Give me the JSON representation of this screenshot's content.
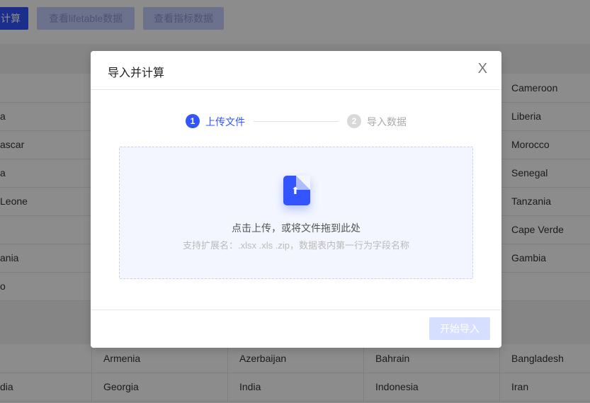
{
  "toolbar": {
    "calc": "计算",
    "lifetable": "查看lifetable数据",
    "indicator": "查看指标数据"
  },
  "table": {
    "rows": [
      [
        "",
        "",
        "",
        "",
        "Cameroon"
      ],
      [
        "a",
        "",
        "",
        "",
        "Liberia"
      ],
      [
        "ascar",
        "",
        "",
        "",
        "Morocco"
      ],
      [
        "a",
        "",
        "",
        "",
        "Senegal"
      ],
      [
        "Leone",
        "",
        "",
        "",
        "Tanzania"
      ],
      [
        "",
        "",
        "",
        "",
        "Cape Verde"
      ],
      [
        "ania",
        "",
        "",
        "",
        "Gambia"
      ],
      [
        "o",
        "",
        "",
        "",
        ""
      ]
    ],
    "rows2": [
      [
        "",
        "Armenia",
        "Azerbaijan",
        "Bahrain",
        "Bangladesh"
      ],
      [
        "dia",
        "Georgia",
        "India",
        "Indonesia",
        "Iran"
      ]
    ]
  },
  "modal": {
    "title": "导入并计算",
    "close": "X",
    "steps": [
      {
        "num": "1",
        "label": "上传文件",
        "color": "#3355ff"
      },
      {
        "num": "2",
        "label": "导入数据",
        "color": "#d0d0d0"
      }
    ],
    "upload_text": "点击上传，或将文件拖到此处",
    "hint": "支持扩展名：.xlsx .xls .zip，数据表内第一行为字段名称",
    "start": "开始导入"
  }
}
